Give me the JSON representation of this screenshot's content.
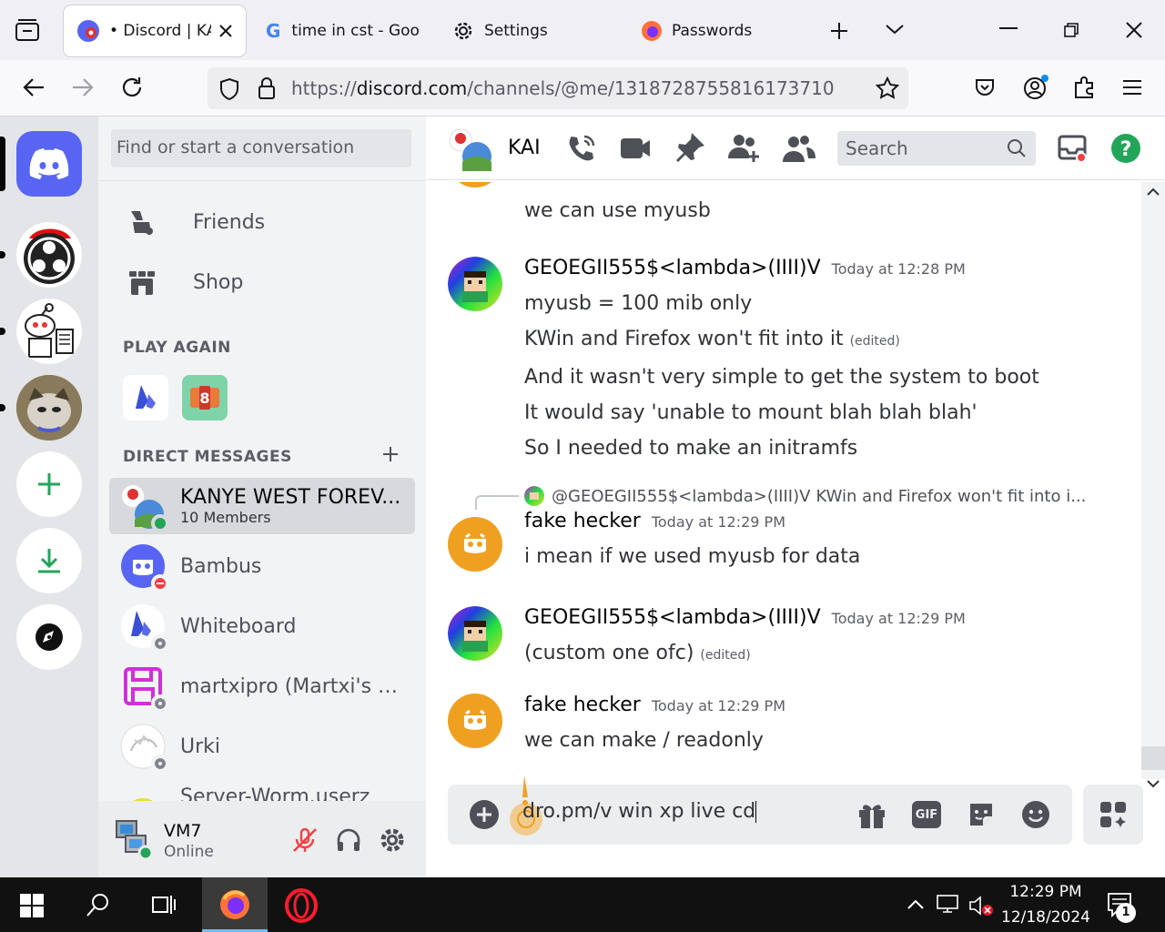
{
  "browser": {
    "tabs": [
      {
        "label": "• Discord | KAN",
        "active": true
      },
      {
        "label": "time in cst - Goog",
        "active": false
      },
      {
        "label": "Settings",
        "active": false
      },
      {
        "label": "Passwords",
        "active": false
      }
    ],
    "url_prefix": "https://",
    "url_host": "discord.com",
    "url_path": "/channels/@me/1318728755816173710"
  },
  "dm_panel": {
    "search_placeholder": "Find or start a conversation",
    "nav": {
      "friends": "Friends",
      "shop": "Shop"
    },
    "play_again_label": "PLAY AGAIN",
    "direct_messages_label": "DIRECT MESSAGES",
    "dms": [
      {
        "name": "KANYE WEST FOREV...",
        "sub": "10 Members",
        "status": "online",
        "selected": true
      },
      {
        "name": "Bambus",
        "status": "dnd"
      },
      {
        "name": "Whiteboard",
        "status": "offline"
      },
      {
        "name": "martxipro (Martxi's ve...",
        "status": "offline"
      },
      {
        "name": "Urki",
        "status": "offline"
      },
      {
        "name": "Server-Worm.userz",
        "status": "none"
      }
    ]
  },
  "user": {
    "name": "VM7",
    "status": "Online"
  },
  "chat": {
    "channel_name": "KAI",
    "search_placeholder": "Search",
    "messages": [
      {
        "type": "continuation",
        "lines": [
          "we can use myusb"
        ]
      },
      {
        "author": "GEOEGII555$<lambda>(IIII)V",
        "time": "Today at 12:28 PM",
        "lines": [
          {
            "text": "myusb = 100 mib only",
            "edited": ""
          },
          {
            "text": "KWin and Firefox won't fit into it",
            "edited": "(edited)"
          },
          {
            "text": "And it wasn't very simple to get the system to boot",
            "edited": ""
          },
          {
            "text": "It would say 'unable to mount blah blah blah'",
            "edited": ""
          },
          {
            "text": "So I needed to make an initramfs",
            "edited": ""
          }
        ]
      },
      {
        "reply_author": "@GEOEGII555$<lambda>(IIII)V",
        "reply_text": "KWin and Firefox won't fit into i...",
        "author": "fake hecker",
        "time": "Today at 12:29 PM",
        "lines": [
          {
            "text": "i mean if we used myusb for data",
            "edited": ""
          }
        ]
      },
      {
        "author": "GEOEGII555$<lambda>(IIII)V",
        "time": "Today at 12:29 PM",
        "lines": [
          {
            "text": "(custom one ofc)",
            "edited": "(edited)"
          }
        ]
      },
      {
        "author": "fake hecker",
        "time": "Today at 12:29 PM",
        "lines": [
          {
            "text": "we can make / readonly",
            "edited": ""
          }
        ]
      }
    ],
    "composer_value": "dro.pm/v win xp live cd",
    "gif_label": "GIF"
  },
  "taskbar": {
    "time": "12:29 PM",
    "date": "12/18/2024",
    "notifications": "1"
  },
  "colors": {
    "blurple": "#5865f2",
    "green": "#23a559",
    "dnd": "#f23f43",
    "offline": "#80848e",
    "orange": "#f0a020"
  }
}
